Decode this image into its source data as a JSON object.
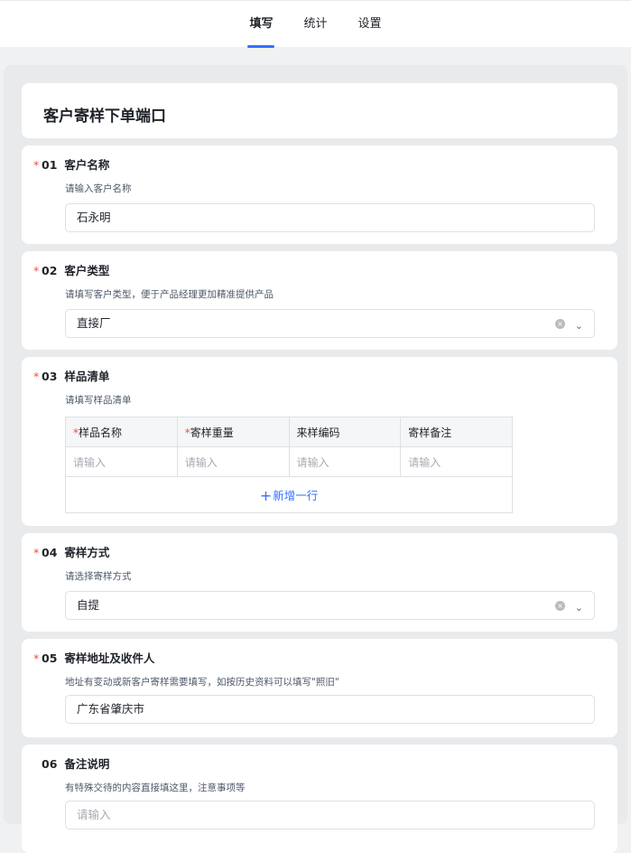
{
  "tabs": [
    {
      "label": "填写",
      "active": true
    },
    {
      "label": "统计",
      "active": false
    },
    {
      "label": "设置",
      "active": false
    }
  ],
  "form": {
    "title": "客户寄样下单端口"
  },
  "questions": [
    {
      "required": "*",
      "number": "01",
      "title": "客户名称",
      "desc": "请输入客户名称",
      "value": "石永明"
    },
    {
      "required": "*",
      "number": "02",
      "title": "客户类型",
      "desc": "请填写客户类型，便于产品经理更加精准提供产品",
      "value": "直接厂"
    },
    {
      "required": "*",
      "number": "03",
      "title": "样品清单",
      "desc": "请填写样品清单"
    },
    {
      "required": "*",
      "number": "04",
      "title": "寄样方式",
      "desc": "请选择寄样方式",
      "value": "自提"
    },
    {
      "required": "*",
      "number": "05",
      "title": "寄样地址及收件人",
      "desc": "地址有变动或新客户寄样需要填写，如按历史资料可以填写\"照旧\"",
      "value": "广东省肇庆市"
    },
    {
      "required": "",
      "number": "06",
      "title": "备注说明",
      "desc": "有特殊交待的内容直接填这里，注意事项等",
      "placeholder": "请输入"
    }
  ],
  "table": {
    "columns": [
      {
        "required": "*",
        "label": "样品名称"
      },
      {
        "required": "*",
        "label": "寄样重量"
      },
      {
        "required": "",
        "label": "来样编码"
      },
      {
        "required": "",
        "label": "寄样备注"
      }
    ],
    "row_placeholders": [
      "请输入",
      "请输入",
      "请输入",
      "请输入"
    ],
    "add_row_icon": "+",
    "add_row_label": "新增一行"
  },
  "icons": {
    "clear": "×",
    "chevron": "⌄"
  },
  "colors": {
    "accent": "#3370ff",
    "required": "#f54a45"
  }
}
